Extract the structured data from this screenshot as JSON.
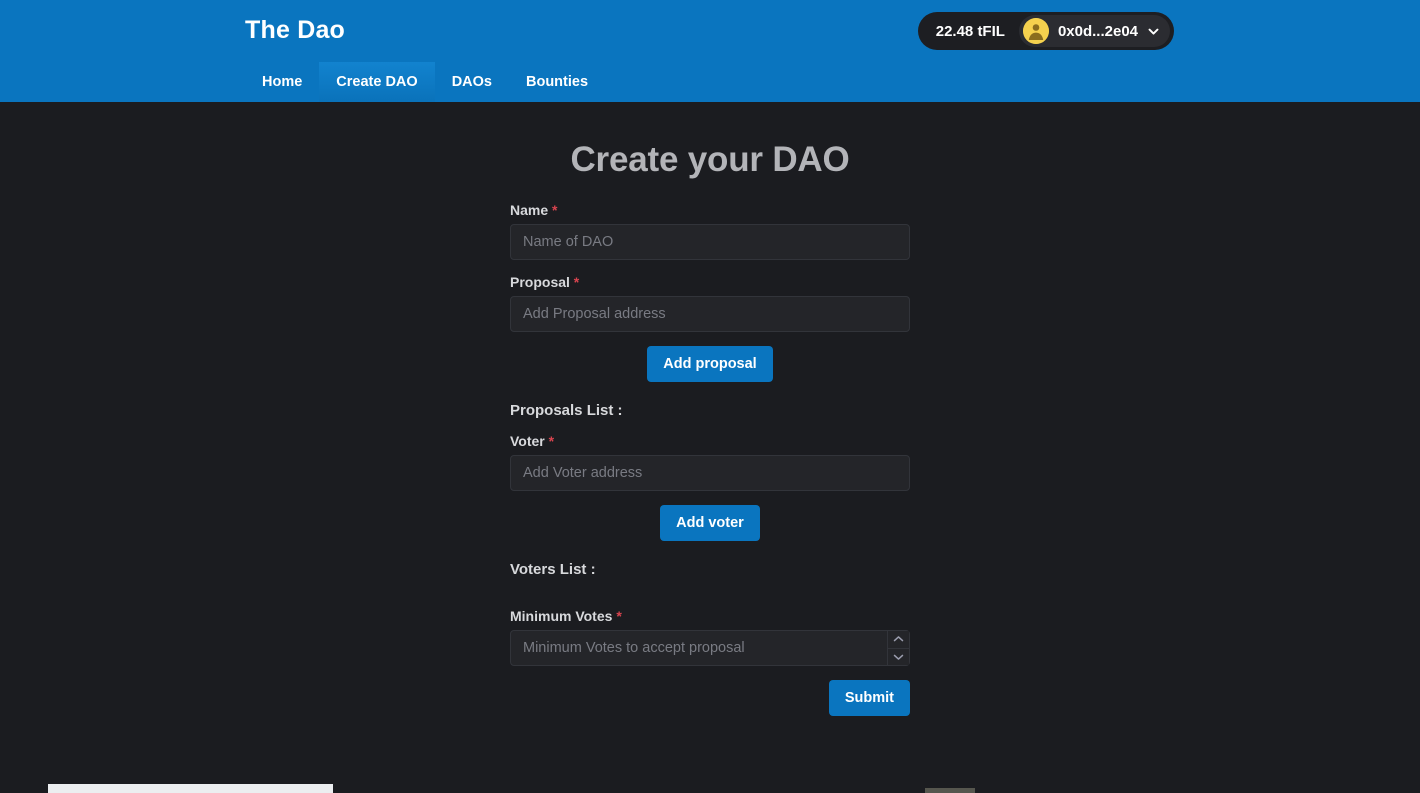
{
  "header": {
    "brand": "The Dao",
    "wallet": {
      "balance": "22.48 tFIL",
      "address": "0x0d...2e04",
      "avatar_icon": "user-avatar-icon",
      "chevron_icon": "chevron-down-icon"
    },
    "nav": [
      {
        "label": "Home",
        "active": false
      },
      {
        "label": "Create DAO",
        "active": true
      },
      {
        "label": "DAOs",
        "active": false
      },
      {
        "label": "Bounties",
        "active": false
      }
    ]
  },
  "main": {
    "title": "Create your DAO",
    "fields": {
      "name": {
        "label": "Name",
        "required_marker": "*",
        "placeholder": "Name of DAO",
        "value": ""
      },
      "proposal": {
        "label": "Proposal",
        "required_marker": "*",
        "placeholder": "Add Proposal address",
        "value": ""
      },
      "voter": {
        "label": "Voter",
        "required_marker": "*",
        "placeholder": "Add Voter address",
        "value": ""
      },
      "minimum_votes": {
        "label": "Minimum Votes",
        "required_marker": "*",
        "placeholder": "Minimum Votes to accept proposal",
        "value": "",
        "spinner_up_icon": "chevron-up-icon",
        "spinner_down_icon": "chevron-down-icon"
      }
    },
    "buttons": {
      "add_proposal": "Add proposal",
      "add_voter": "Add voter",
      "submit": "Submit"
    },
    "lists": {
      "proposals_heading": "Proposals List :",
      "proposals_items": [],
      "voters_heading": "Voters List :",
      "voters_items": []
    }
  },
  "colors": {
    "brand_blue": "#0a75bf",
    "active_tab_blue": "#1283cf",
    "page_background": "#1b1c20",
    "input_background": "#242529",
    "input_border": "#32343a",
    "label_text": "#d8d9dc",
    "placeholder_text": "#797b83",
    "title_text": "#b3b4b8",
    "required_red": "#d9444f",
    "avatar_yellow": "#f5d14e"
  }
}
